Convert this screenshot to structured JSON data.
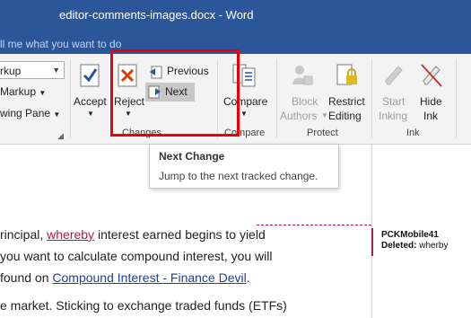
{
  "window": {
    "title": "editor-comments-images.docx - Word",
    "tell_me": "ll me what you want to do"
  },
  "ribbon": {
    "left_panel": {
      "dropdown_value": "rkup",
      "markup_label": "Markup",
      "pane_label": "wing Pane"
    },
    "accept": {
      "label": "Accept"
    },
    "reject": {
      "label": "Reject"
    },
    "previous": {
      "label": "Previous"
    },
    "next": {
      "label": "Next"
    },
    "changes_group_label": "Changes",
    "compare": {
      "label": "Compare",
      "group_label": "Compare"
    },
    "block_authors": {
      "line1": "Block",
      "line2": "Authors"
    },
    "restrict_editing": {
      "line1": "Restrict",
      "line2": "Editing"
    },
    "protect_group_label": "Protect",
    "start_inking": {
      "line1": "Start",
      "line2": "Inking"
    },
    "hide_ink": {
      "line1": "Hide",
      "line2": "Ink"
    },
    "ink_group_label": "Ink"
  },
  "tooltip": {
    "title": "Next Change",
    "description": "Jump to the next tracked change."
  },
  "document": {
    "line1_pre": "rincipal, ",
    "line1_deleted": "whereby",
    "line1_post": " interest earned begins to yield",
    "line2": "you want to calculate compound interest, you will",
    "line3_pre": "found on ",
    "line3_link": "Compound Interest - Finance Devil",
    "line3_post": ".",
    "line4": "e market. Sticking to exchange traded funds (ETFs)"
  },
  "comment": {
    "author": "PCKMobile41",
    "action": "Deleted:",
    "text": "wherby"
  },
  "colors": {
    "title_bar": "#2b579a",
    "highlight_box": "#e8000b",
    "track_change": "#b01a46",
    "link": "#1f3f9a"
  }
}
